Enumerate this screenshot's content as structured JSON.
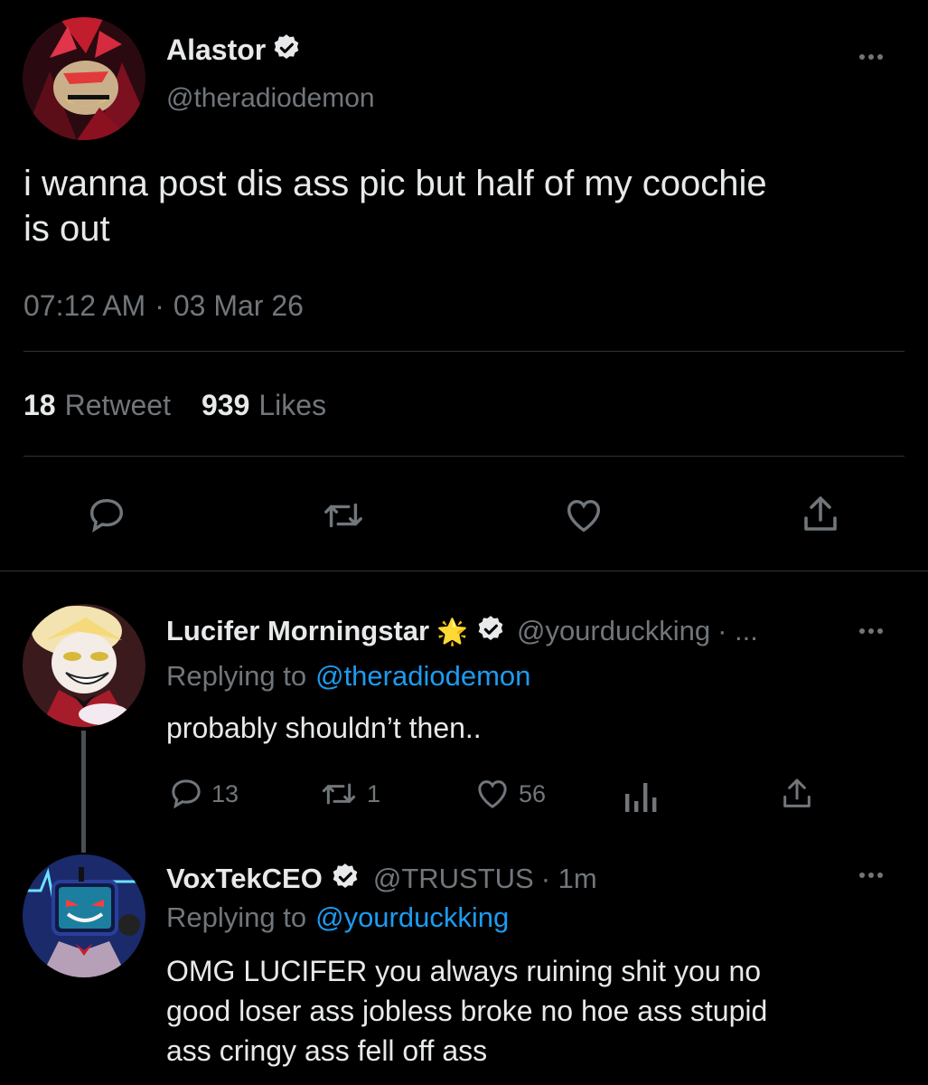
{
  "main_tweet": {
    "display_name": "Alastor",
    "handle": "@theradiodemon",
    "text_line1": "i wanna post dis ass pic but half of my coochie",
    "text_line2": "is out",
    "time": "07:12 AM",
    "separator": "·",
    "date": "03 Mar 26",
    "retweet_count": "18",
    "retweet_label": "Retweet",
    "likes_count": "939",
    "likes_label": "Likes"
  },
  "reply1": {
    "display_name": "Lucifer Morningstar",
    "badge_emoji": "🌟",
    "handle": "@yourduckking",
    "meta_suffix": "· ...",
    "replying_prefix": "Replying to",
    "replying_to": "@theradiodemon",
    "text": "probably shouldn’t then..",
    "reply_count": "13",
    "retweet_count": "1",
    "like_count": "56"
  },
  "reply2": {
    "display_name": "VoxTekCEO",
    "handle": "@TRUSTUS",
    "meta_suffix": "· 1m",
    "replying_prefix": "Replying to",
    "replying_to": "@yourduckking",
    "text_line1": "OMG LUCIFER you always ruining shit you no",
    "text_line2": "good loser ass jobless broke no hoe ass stupid",
    "text_line3": "ass cringy ass fell off ass"
  },
  "colors": {
    "background": "#000000",
    "text": "#e7e9ea",
    "muted": "#71767b",
    "link": "#1d9bf0",
    "divider": "#2f3336"
  },
  "icons": [
    "more-icon",
    "verified-icon",
    "reply-icon",
    "retweet-icon",
    "like-icon",
    "share-icon",
    "analytics-icon",
    "star-emoji"
  ]
}
